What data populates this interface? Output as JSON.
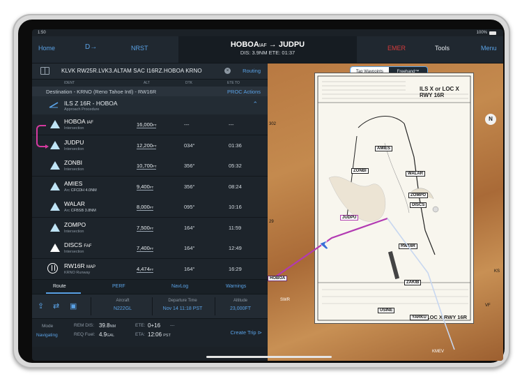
{
  "status_bar": {
    "time": "1:50",
    "battery": "100%"
  },
  "nav": {
    "home": "Home",
    "direct_to": "D→",
    "nrst": "NRST",
    "leg_from": "HOBOA",
    "leg_from_suffix": "IAF",
    "leg_arrow": "→",
    "leg_to": "JUDPU",
    "leg_sub": "DIS: 3.9NM  ETE: 01:37",
    "emer": "EMER",
    "tools": "Tools",
    "menu": "Menu"
  },
  "route_bar": {
    "route": "KLVK RW25R.LVK3.ALTAM SAC I16RZ.HOBOA KRNO",
    "routing": "Routing"
  },
  "columns": {
    "ident": "IDENT",
    "alt": "ALT",
    "dtk": "DTK",
    "ete": "ETE TO"
  },
  "destination": {
    "text": "Destination - KRNO (Reno Tahoe Intl) - RW16R",
    "proc": "PROC",
    "actions": "Actions"
  },
  "procedure": {
    "title": "ILS Z 16R - HOBOA",
    "subtitle": "Approach Procedure"
  },
  "waypoints": [
    {
      "name": "HOBOA",
      "suffix": "IAF",
      "desc": "Intersection",
      "desc_bold": "",
      "alt": "16,000",
      "alt_unit": "FT",
      "dtk": "---",
      "ete": "---",
      "icon": "triangle"
    },
    {
      "name": "JUDPU",
      "suffix": "",
      "desc": "Intersection",
      "desc_bold": "",
      "alt": "12,200",
      "alt_unit": "FT",
      "dtk": "034°",
      "ete": "01:36",
      "icon": "triangle"
    },
    {
      "name": "ZONBI",
      "suffix": "",
      "desc": "Intersection",
      "desc_bold": "",
      "alt": "10,700",
      "alt_unit": "FT",
      "dtk": "356°",
      "ete": "05:32",
      "icon": "triangle"
    },
    {
      "name": "AMIES",
      "suffix": "",
      "desc": "Arc",
      "desc_bold": "CFCDH 4.0NM",
      "alt": "9,400",
      "alt_unit": "FT",
      "dtk": "356°",
      "ete": "08:24",
      "icon": "triangle"
    },
    {
      "name": "WALAR",
      "suffix": "",
      "desc": "Arc",
      "desc_bold": "CFBSB 3.8NM",
      "alt": "8,000",
      "alt_unit": "FT",
      "dtk": "095°",
      "ete": "10:16",
      "icon": "triangle"
    },
    {
      "name": "ZOMPO",
      "suffix": "",
      "desc": "Intersection",
      "desc_bold": "",
      "alt": "7,500",
      "alt_unit": "FT",
      "dtk": "164°",
      "ete": "11:59",
      "icon": "triangle"
    },
    {
      "name": "DISCS",
      "suffix": "FAF",
      "desc": "Intersection",
      "desc_bold": "",
      "alt": "7,400",
      "alt_unit": "FT",
      "dtk": "164°",
      "ete": "12:49",
      "icon": "triangle-white"
    },
    {
      "name": "RW16R",
      "suffix": "MAP",
      "desc": "KRNO Runway",
      "desc_bold": "",
      "alt": "4,474",
      "alt_unit": "FT",
      "dtk": "164°",
      "ete": "16:29",
      "icon": "runway"
    }
  ],
  "tabs": [
    "Route",
    "PERF",
    "NavLog",
    "Warnings"
  ],
  "details": {
    "aircraft_label": "Aircraft",
    "aircraft": "N222GL",
    "dep_label": "Departure Time",
    "dep": "Nov 14 11:18 PST",
    "alt_label": "Altitude",
    "alt": "23,000FT"
  },
  "footer": {
    "mode_label": "Mode",
    "mode": "Navigating",
    "rem_dis_label": "REM DIS:",
    "rem_dis": "39.8",
    "rem_dis_unit": "NM",
    "req_fuel_label": "REQ Fuel:",
    "req_fuel": "4.9",
    "req_fuel_unit": "GAL",
    "ete_label": "ETE:",
    "ete": "0+16",
    "ete_extra": "---",
    "eta_label": "ETA:",
    "eta": "12:06",
    "eta_unit": "PST",
    "create_trip": "Create Trip"
  },
  "map": {
    "tap_waypoints": "Tap Waypoints",
    "freehand": "Freehand™",
    "chart_title": "ILS X or LOC X RWY 16R",
    "chart_title_bottom": "LOC X RWY 16R",
    "labels": [
      "AMIES",
      "WALAR",
      "ZONBI",
      "ZOMPO",
      "DISCS",
      "RW16R",
      "ZAKIB",
      "USINE",
      "YARKU",
      "JUDPU",
      "HOBOA",
      "SWR",
      "KMEV",
      "KS",
      "302",
      "29",
      "VF"
    ],
    "compass": "N"
  },
  "colors": {
    "accent": "#5aa2e6",
    "route": "#d63aa0",
    "emer": "#d83c3c",
    "panel": "#1d242b"
  }
}
